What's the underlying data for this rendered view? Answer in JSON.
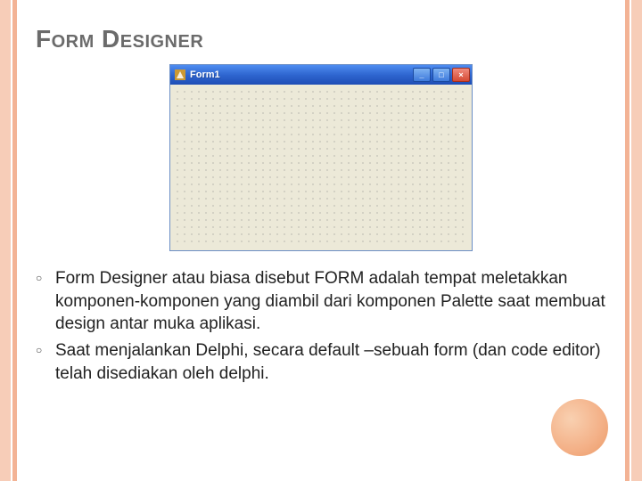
{
  "heading": "Form Designer",
  "formWindow": {
    "title": "Form1",
    "minimize": "_",
    "maximize": "□",
    "close": "×"
  },
  "bullets": [
    "Form Designer atau biasa disebut FORM adalah tempat meletakkan komponen-komponen yang diambil dari komponen Palette saat membuat design antar muka aplikasi.",
    "Saat menjalankan Delphi, secara default –sebuah form (dan code editor) telah disediakan oleh delphi."
  ]
}
